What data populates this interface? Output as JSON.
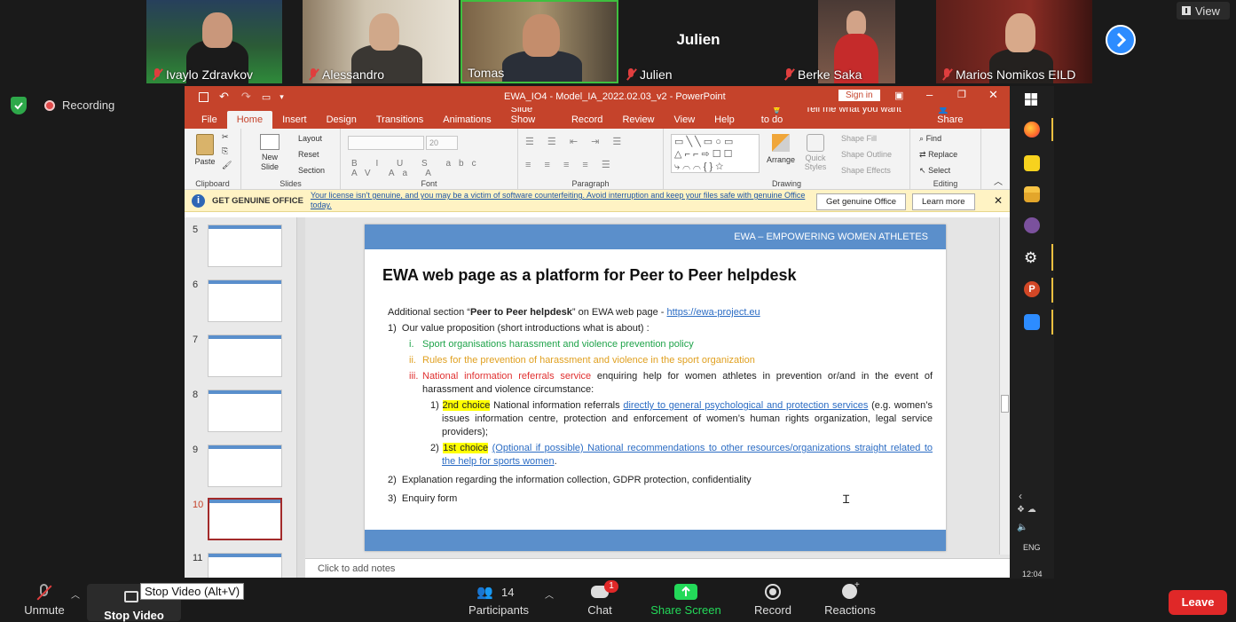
{
  "top": {
    "view_label": "View",
    "recording_label": "Recording",
    "participants": [
      {
        "name": "Ivaylo Zdravkov"
      },
      {
        "name": "Alessandro"
      },
      {
        "name": "Tomas"
      },
      {
        "name": "Julien",
        "big_name": "Julien"
      },
      {
        "name": "Berke Saka"
      },
      {
        "name": "Marios Nomikos EILD"
      }
    ]
  },
  "ppt": {
    "doc_title": "EWA_IO4 - Model_IA_2022.02.03_v2 - PowerPoint",
    "sign_in": "Sign in",
    "menu": [
      "File",
      "Home",
      "Insert",
      "Design",
      "Transitions",
      "Animations",
      "Slide Show",
      "Record",
      "Review",
      "View",
      "Help"
    ],
    "tell_me": "Tell me what you want to do",
    "share": "Share",
    "ribbon": {
      "paste": "Paste",
      "clipboard": "Clipboard",
      "new_slide": "New Slide",
      "layout": "Layout",
      "reset": "Reset",
      "section": "Section",
      "slides": "Slides",
      "font_size": "20",
      "font": "Font",
      "paragraph": "Paragraph",
      "arrange": "Arrange",
      "quick_styles": "Quick Styles",
      "shape_fill": "Shape Fill",
      "shape_outline": "Shape Outline",
      "shape_effects": "Shape Effects",
      "drawing": "Drawing",
      "find": "Find",
      "replace": "Replace",
      "select": "Select",
      "editing": "Editing"
    },
    "license": {
      "title": "GET GENUINE OFFICE",
      "message": "Your license isn't genuine, and you may be a victim of software counterfeiting. Avoid interruption and keep your files safe with genuine Office today.",
      "get_button": "Get genuine Office",
      "learn_button": "Learn more"
    },
    "thumbnails": [
      "5",
      "6",
      "7",
      "8",
      "9",
      "10",
      "11"
    ],
    "slide": {
      "header": "EWA – EMPOWERING WOMEN ATHLETES",
      "title": "EWA web page as a platform for Peer to Peer helpdesk",
      "intro_pre": "Additional section “",
      "intro_bold": "Peer to Peer helpdesk",
      "intro_mid": "” on EWA web page - ",
      "intro_link": "https://ewa-project.eu",
      "item1": "1)  Our value proposition (short introductions what is about) :",
      "i_label": "i.",
      "i_text": "Sport organisations harassment and violence prevention policy",
      "ii_label": "ii.",
      "ii_text": "Rules for the prevention of harassment and violence in the sport organization",
      "iii_label": "iii.",
      "iii_red": "National information referrals service",
      "iii_rest": " enquiring help for women athletes in prevention or/and in the event of harassment and violence circumstance:",
      "c1_num": "1)",
      "c1_hl": "2nd choice",
      "c1_mid": " National information referrals ",
      "c1_link": "directly to general psychological and protection services",
      "c1_rest": " (e.g. women’s issues information centre, protection and enforcement of women’s human rights organization, legal service providers);",
      "c2_num": "2)",
      "c2_hl": "1st choice",
      "c2_link": "(Optional if possible) National recommendations to other resources/organizations straight related to the help for sports women",
      "item2": "2)  Explanation regarding the information collection, GDPR protection, confidentiality",
      "item3": "3)  Enquiry form"
    },
    "notes_placeholder": "Click to add notes"
  },
  "taskbar": {
    "lang": "ENG",
    "time": "12:04"
  },
  "bottom": {
    "unmute": "Unmute",
    "stop_video": "Stop Video",
    "tooltip": "Stop Video (Alt+V)",
    "participants": "Participants",
    "participants_count": "14",
    "chat": "Chat",
    "chat_badge": "1",
    "share_screen": "Share Screen",
    "record": "Record",
    "reactions": "Reactions",
    "leave": "Leave"
  },
  "colors": {
    "ppt_red": "#c5432b",
    "slide_blue": "#5b8fcb",
    "share_green": "#23d959",
    "leave_red": "#e02828"
  }
}
